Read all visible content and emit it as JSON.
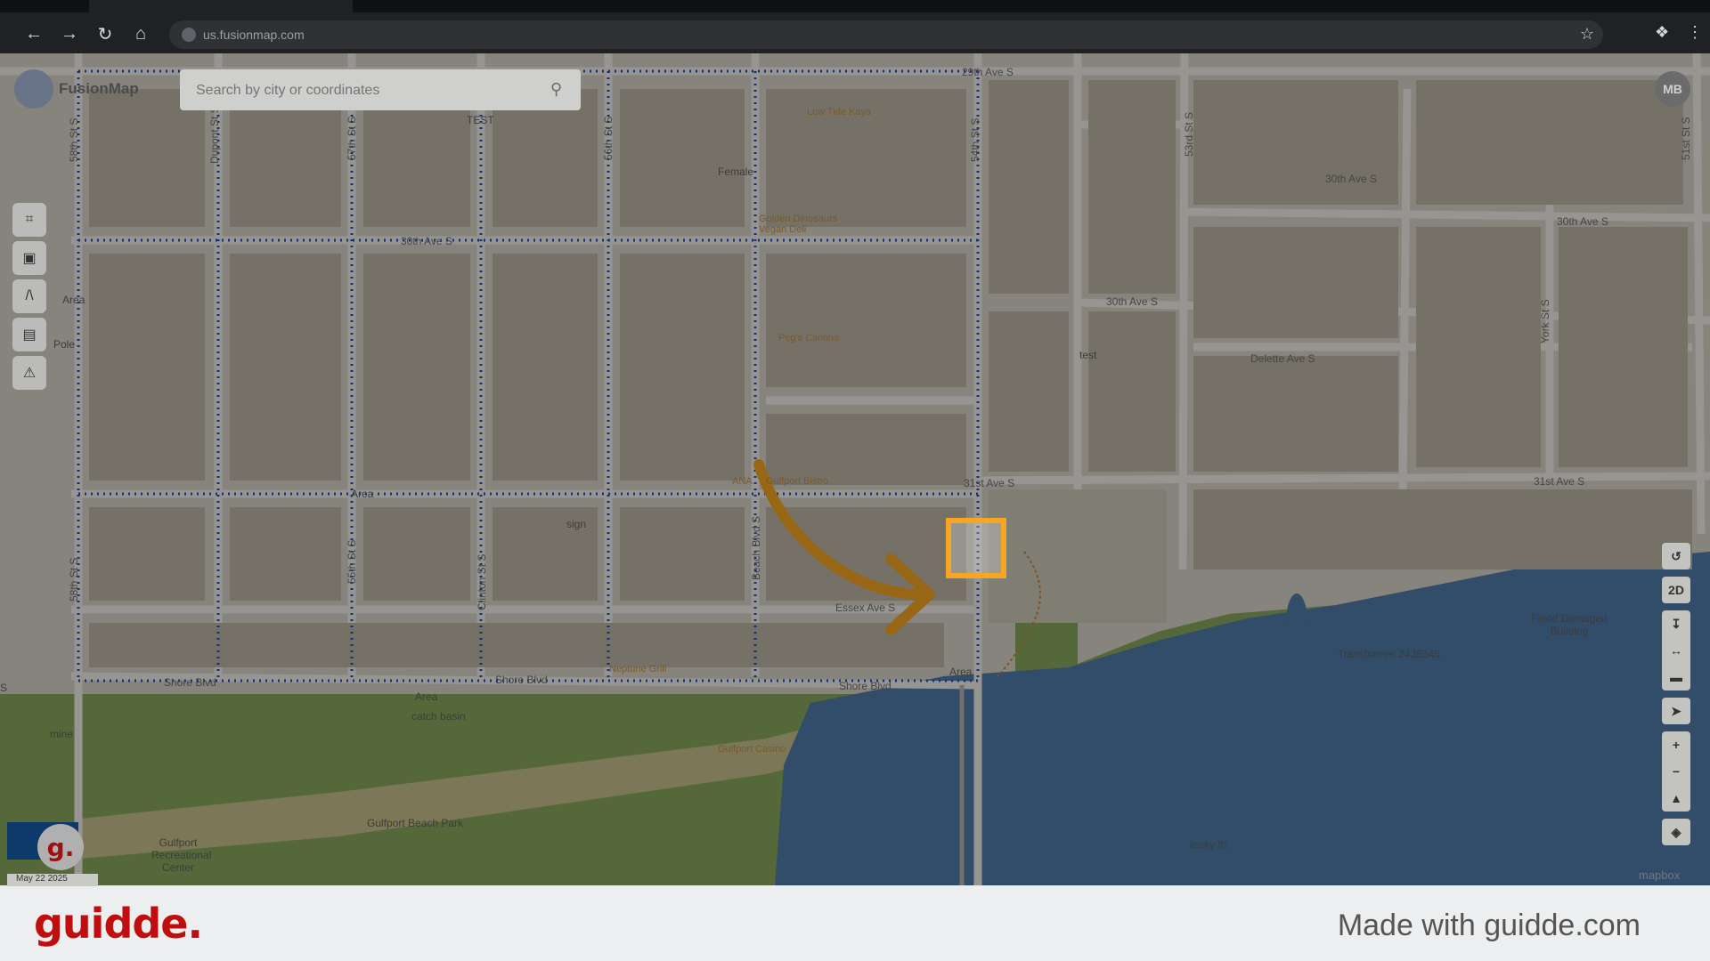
{
  "browser": {
    "url": "us.fusionmap.com"
  },
  "app": {
    "brand": "FusionMap",
    "search_placeholder": "Search by city or coordinates",
    "avatar_initials": "MB",
    "view_mode": "2D",
    "date_chip": "May 22 2025",
    "mapbox": "mapbox"
  },
  "map_labels": {
    "street_29th": "29th Ave S",
    "street_30th_left": "30th Ave S",
    "street_30th_mid": "30th Ave S",
    "street_30th_right": "30th Ave S",
    "street_30th_far": "30th Ave S",
    "street_31st_mid": "31st Ave S",
    "street_31st_right": "31st Ave S",
    "delette": "Delette Ave S",
    "essex": "Essex Ave S",
    "shore_left": "Shore Blvd",
    "shore_mid": "Shore Blvd",
    "shore_right": "Shore Blvd",
    "beach_blvd": "Beach Blvd S",
    "st_58th_top": "58th St S",
    "st_58th_bottom": "58th St S",
    "st_57th": "57th St S",
    "st_56th": "56th St S",
    "st_55th": "55th St S",
    "st_54th": "54th St S",
    "st_53rd": "53rd St S",
    "st_51st": "51st St S",
    "york": "York St S",
    "dupont": "Dupont St S",
    "clinton": "Clinton St S",
    "low_tide": "Low Tide Kaya",
    "golden_dinosaurs": "Golden Dinosaurs Vegan Deli",
    "pegs_cantina": "Peg's Cantina",
    "gulfport_bistro": "Gulfport Bistro",
    "neptune_grill": "Neptune Grill",
    "gulfport_casino": "Gulfport Casino",
    "gulfport_beach_park": "Gulfport Beach Park",
    "gulfport_rec": "Gulfport Recreational Center",
    "female": "Female",
    "test_top": "TEST",
    "test": "test",
    "pole": "Pole",
    "area_left": "Area",
    "area_mid": "Area",
    "area_shore": "Area",
    "area_bottom": "Area",
    "area_ana": "ANA",
    "sign": "sign",
    "catch_basin": "catch basin",
    "mine": "mine",
    "flood_damaged": "Flood Damaged Building",
    "transformer": "Transformer 2435345",
    "leaky_fh": "leaky fh",
    "s_edge": "S"
  },
  "footer": {
    "logo": "guidde.",
    "made_with": "Made with guidde.com"
  },
  "icons": {
    "back": "back-arrow-icon",
    "forward": "forward-arrow-icon",
    "reload": "reload-icon",
    "home": "home-icon"
  },
  "colors": {
    "accent_highlight": "#f5a623",
    "brand_red": "#c00d0d",
    "water": "#2f4a66",
    "park": "#5c7a3a"
  }
}
